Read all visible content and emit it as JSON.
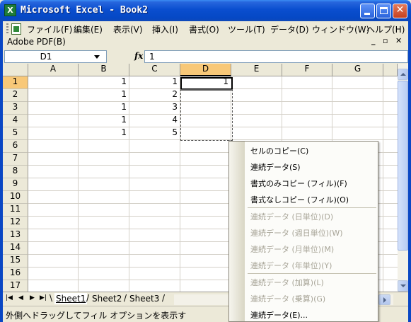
{
  "window": {
    "title": "Microsoft Excel - Book2"
  },
  "menu": [
    "ファイル(F)",
    "編集(E)",
    "表示(V)",
    "挿入(I)",
    "書式(O)",
    "ツール(T)",
    "データ(D)",
    "ウィンドウ(W)",
    "ヘルプ(H)"
  ],
  "pdfbar": {
    "label": "Adobe PDF(B)"
  },
  "formula_bar": {
    "name_box": "D1",
    "fx": "fx",
    "value": "1"
  },
  "columns": [
    "A",
    "B",
    "C",
    "D",
    "E",
    "F",
    "G"
  ],
  "rows": [
    "1",
    "2",
    "3",
    "4",
    "5",
    "6",
    "7",
    "8",
    "9",
    "10",
    "11",
    "12",
    "13",
    "14",
    "15",
    "16",
    "17"
  ],
  "cells": {
    "B1": "1",
    "B2": "1",
    "B3": "1",
    "B4": "1",
    "B5": "1",
    "C1": "1",
    "C2": "2",
    "C3": "3",
    "C4": "4",
    "C5": "5",
    "D1": "1"
  },
  "selected": {
    "column": "D",
    "row": "1"
  },
  "sheet_tabs": [
    "Sheet1",
    "Sheet2",
    "Sheet3"
  ],
  "active_sheet": "Sheet1",
  "status": "外側へドラッグしてフィル オプションを表示す",
  "context_menu": {
    "group1": [
      {
        "label": "セルのコピー(C)",
        "enabled": true
      },
      {
        "label": "連続データ(S)",
        "enabled": true
      },
      {
        "label": "書式のみコピー (フィル)(F)",
        "enabled": true
      },
      {
        "label": "書式なしコピー (フィル)(O)",
        "enabled": true
      }
    ],
    "group2": [
      {
        "label": "連続データ (日単位)(D)",
        "enabled": false
      },
      {
        "label": "連続データ (週日単位)(W)",
        "enabled": false
      },
      {
        "label": "連続データ (月単位)(M)",
        "enabled": false
      },
      {
        "label": "連続データ (年単位)(Y)",
        "enabled": false
      }
    ],
    "group3": [
      {
        "label": "連続データ (加算)(L)",
        "enabled": false
      },
      {
        "label": "連続データ (乗算)(G)",
        "enabled": false
      },
      {
        "label": "連続データ(E)...",
        "enabled": true
      }
    ]
  }
}
